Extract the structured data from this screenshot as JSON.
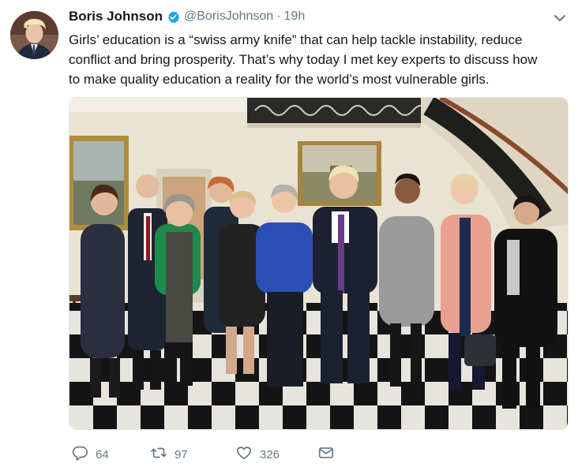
{
  "tweet": {
    "author_name": "Boris Johnson",
    "handle": "@BorisJohnson",
    "separator": "·",
    "time": "19h",
    "text_lines": [
      "Girls’ education is a “swiss army knife” that can help tackle instability, reduce",
      "conflict and bring prosperity. That’s why today I met key experts to discuss how",
      "to make quality education a reality for the world’s most vulnerable girls."
    ],
    "actions": {
      "reply_count": "64",
      "retweet_count": "97",
      "like_count": "326"
    },
    "icons": {
      "verified": "verified-badge-icon",
      "caret": "chevron-down-icon",
      "reply": "reply-icon",
      "retweet": "retweet-icon",
      "like": "heart-icon",
      "dm": "envelope-icon"
    },
    "colors": {
      "verified": "#1da1f2",
      "secondary_text": "#657786",
      "primary_text": "#14171a"
    }
  }
}
